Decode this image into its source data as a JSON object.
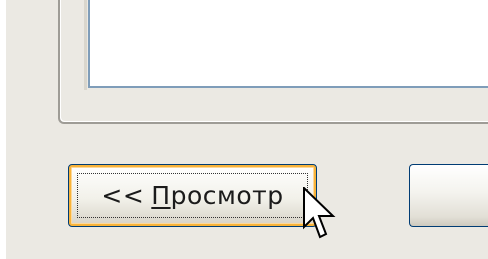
{
  "buttons": {
    "preview_prefix": "<<",
    "preview_access_key": "П",
    "preview_rest": "росмотр"
  },
  "colors": {
    "dialog_background": "#ebe9e3",
    "button_border": "#003c74",
    "focus_highlight": "#f8b33a",
    "listbox_border": "#7f9db9"
  },
  "icons": {
    "cursor": "arrow-pointer-icon"
  }
}
